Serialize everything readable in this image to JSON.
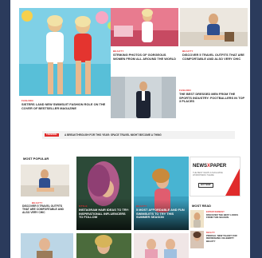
{
  "colors": {
    "frame": "#2b3b5c",
    "accent": "#e02b2b",
    "text": "#222222"
  },
  "top": {
    "feature": {
      "category": "FASHION",
      "title": "SISTERS LAND NEW SWIMSUIT FASHION ROLE ON THE COVER OF BESTSELLER MAGAZINE"
    },
    "cards": [
      {
        "category": "BEAUTY",
        "title": "STRIKING PHOTOS OF GORGEOUS WOMEN FROM ALL AROUND THE WORLD"
      },
      {
        "category": "BEAUTY",
        "title": "DISCOVER 5 TRAVEL OUTFITS THAT ARE COMFORTABLE AND ALSO VERY CHIC"
      },
      {
        "category": "FASHION",
        "title": "THE BEST DRESSED MEN FROM THE SPORTS INDUSTRY: FOOTBALLERS IN TOP 3 PLACES"
      }
    ]
  },
  "ticker": {
    "badge": "TRENDING",
    "text": "A BREAKTHROUGH FOR THIS YEAR: SPACE TRAVEL MIGHT BECOME A THING"
  },
  "most_popular": {
    "heading": "MOST POPULAR",
    "card": {
      "category": "BEAUTY",
      "title": "DISCOVER 5 TRAVEL OUTFITS THAT ARE COMFORTABLE AND ALSO VERY CHIC"
    }
  },
  "middle": [
    {
      "category": "STYLE",
      "title": "INSTAGRAM HAIR IDEAS TO TRY: INSPIRATIONAL INFLUENCERS TO FOLLOW"
    },
    {
      "category": "BEAUTY",
      "title": "5 MOST AFFORDABLE AND FUN SWIMSUITS TO TRY THIS SUMMER SEASON"
    }
  ],
  "ad": {
    "brand_left": "NEWS",
    "brand_x": "X",
    "brand_right": "PAPER",
    "subtitle": "THE BEST NEWS & MAGAZINE WORDPRESS THEME",
    "button": "BUY NOW"
  },
  "most_read": {
    "heading": "MOST READ",
    "items": [
      {
        "category": "ENTERTAINMENT",
        "title": "DISCOVER THE BEST LOOKS FROM THIS SEASON"
      },
      {
        "category": "BEAUTY",
        "title": "PROFILE: NEW TALENT FOR REFRESHING CELEBRITY BEAUTY"
      }
    ]
  }
}
